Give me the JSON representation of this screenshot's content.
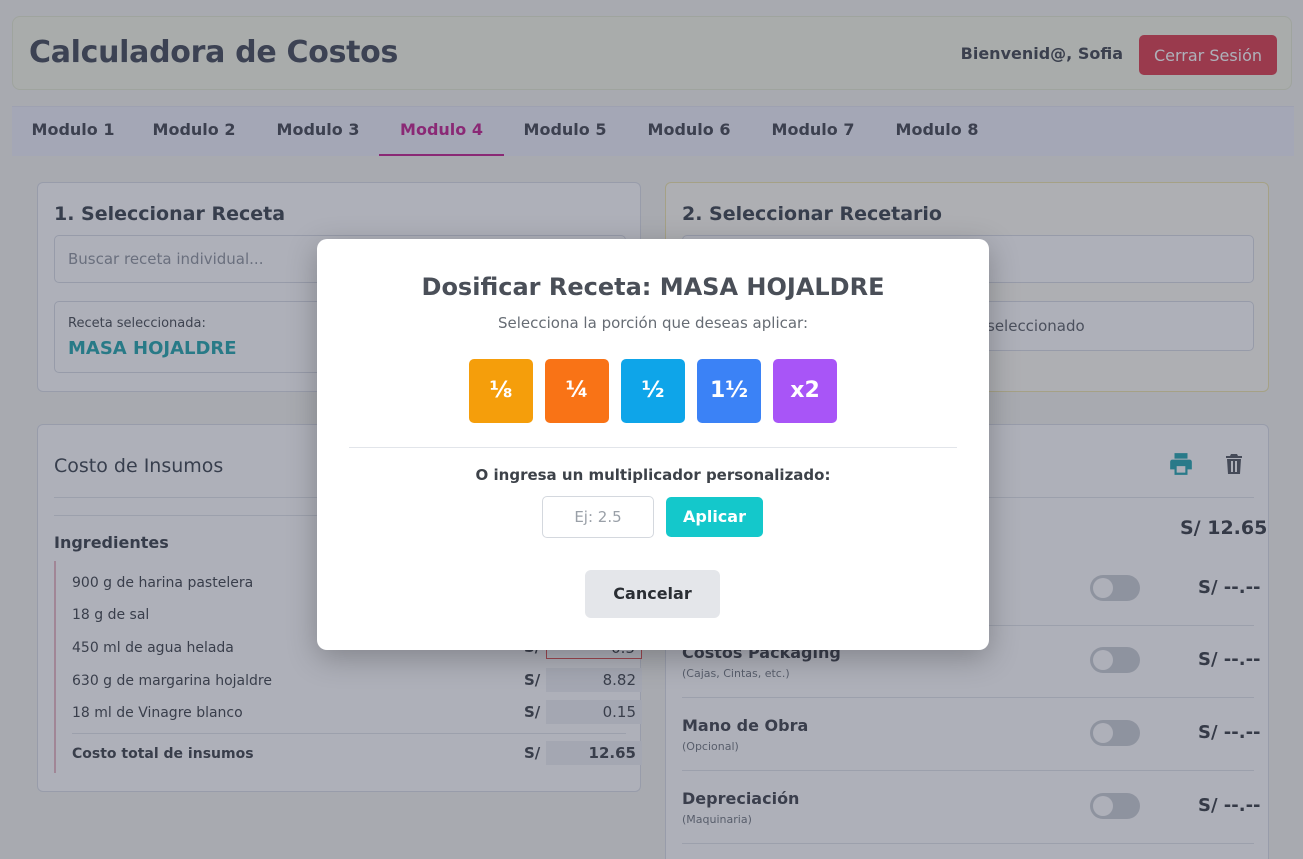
{
  "header": {
    "title": "Calculadora de Costos",
    "welcome": "Bienvenid@, Sofia",
    "logout_label": "Cerrar Sesión"
  },
  "tabs": [
    {
      "label": "Modulo 1",
      "active": false
    },
    {
      "label": "Modulo 2",
      "active": false
    },
    {
      "label": "Modulo 3",
      "active": false
    },
    {
      "label": "Modulo 4",
      "active": true
    },
    {
      "label": "Modulo 5",
      "active": false
    },
    {
      "label": "Modulo 6",
      "active": false
    },
    {
      "label": "Modulo 7",
      "active": false
    },
    {
      "label": "Modulo 8",
      "active": false
    }
  ],
  "recipe_select": {
    "title": "1. Seleccionar Receta",
    "search_placeholder": "Buscar receta individual...",
    "selected_label": "Receta seleccionada:",
    "selected_value": "MASA HOJALDRE"
  },
  "recetario_select": {
    "title": "2. Seleccionar Recetario",
    "status_text": "seleccionado"
  },
  "insumos": {
    "title": "Costo de Insumos",
    "section_label": "Ingredientes",
    "currency": "S/",
    "rows": [
      {
        "name": "900 g de harina pastelera",
        "value": ""
      },
      {
        "name": "18 g de sal",
        "value": ""
      },
      {
        "name": "450 ml de agua helada",
        "value": "0.5"
      },
      {
        "name": "630 g de margarina hojaldre",
        "value": "8.82"
      },
      {
        "name": "18 ml de Vinagre blanco",
        "value": "0.15"
      }
    ],
    "total_label": "Costo total de insumos",
    "total_value": "12.65"
  },
  "costs": {
    "total_value": "S/ 12.65",
    "print_icon": "print-icon",
    "trash_icon": "trash-icon",
    "rows": [
      {
        "name": "",
        "sub": "",
        "value": "S/ --.--"
      },
      {
        "name": "Costos Packaging",
        "sub": "(Cajas, Cintas, etc.)",
        "value": "S/ --.--"
      },
      {
        "name": "Mano de Obra",
        "sub": "(Opcional)",
        "value": "S/ --.--"
      },
      {
        "name": "Depreciación",
        "sub": "(Maquinaria)",
        "value": "S/ --.--"
      }
    ]
  },
  "modal": {
    "title": "Dosificar Receta: MASA HOJALDRE",
    "subtitle": "Selecciona la porción que deseas aplicar:",
    "portions": [
      {
        "label": "⅛",
        "color": "#f59e0b"
      },
      {
        "label": "¼",
        "color": "#f97316"
      },
      {
        "label": "½",
        "color": "#0ea5e9"
      },
      {
        "label": "1½",
        "color": "#3b82f6"
      },
      {
        "label": "x2",
        "color": "#a855f7"
      }
    ],
    "custom_label": "O ingresa un multiplicador personalizado:",
    "multiplier_placeholder": "Ej: 2.5",
    "apply_label": "Aplicar",
    "cancel_label": "Cancelar"
  }
}
